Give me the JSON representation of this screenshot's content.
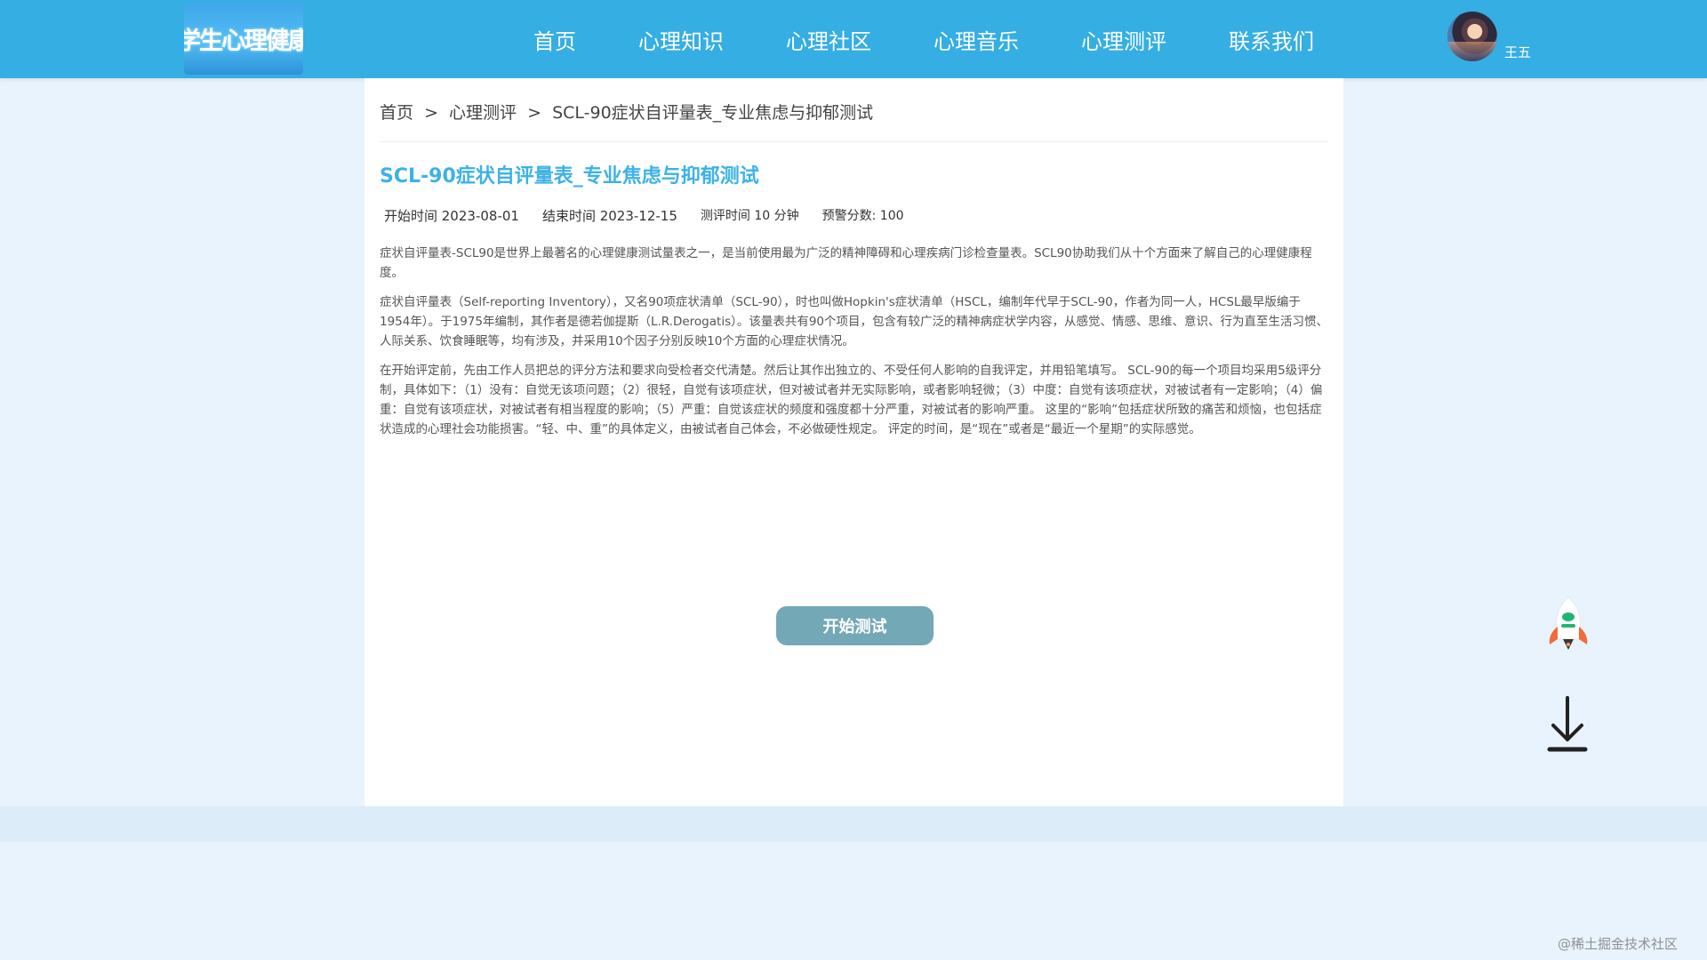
{
  "header": {
    "logo_text": "学生心理健康",
    "nav": [
      "首页",
      "心理知识",
      "心理社区",
      "心理音乐",
      "心理测评",
      "联系我们"
    ],
    "username": "王五",
    "background": "#35aee3"
  },
  "breadcrumb": {
    "home": "首页",
    "separator": ">",
    "section": "心理测评",
    "current": "SCL-90症状自评量表_专业焦虑与抑郁测试"
  },
  "test": {
    "title": "SCL-90症状自评量表_专业焦虑与抑郁测试",
    "title_color": "#3db2e6",
    "start_time": "开始时间 2023-08-01",
    "end_time": "结束时间 2023-12-15",
    "duration": "测评时间 10 分钟",
    "warning_score": "预警分数:  100",
    "paragraphs": [
      "症状自评量表-SCL90是世界上最著名的心理健康测试量表之一，是当前使用最为广泛的精神障碍和心理疾病门诊检查量表。SCL90协助我们从十个方面来了解自己的心理健康程度。",
      "症状自评量表（Self-reporting Inventory），又名90项症状清单（SCL-90），时也叫做Hopkin's症状清单（HSCL，编制年代早于SCL-90，作者为同一人，HCSL最早版编于1954年）。于1975年编制，其作者是德若伽提斯（L.R.Derogatis）。该量表共有90个项目，包含有较广泛的精神病症状学内容，从感觉、情感、思维、意识、行为直至生活习惯、人际关系、饮食睡眠等，均有涉及，并采用10个因子分别反映10个方面的心理症状情况。",
      "在开始评定前，先由工作人员把总的评分方法和要求向受检者交代清楚。然后让其作出独立的、不受任何人影响的自我评定，并用铅笔填写。 SCL-90的每一个项目均采用5级评分制，具体如下：（1）没有：自觉无该项问题；（2）很轻，自觉有该项症状，但对被试者并无实际影响，或者影响轻微；（3）中度：自觉有该项症状，对被试者有一定影响；（4）偏重：自觉有该项症状，对被试者有相当程度的影响；（5）严重：自觉该症状的频度和强度都十分严重，对被试者的影响严重。 这里的“影响”包括症状所致的痛苦和烦恼，也包括症状造成的心理社会功能损害。“轻、中、重”的具体定义，由被试者自己体会，不必做硬性规定。 评定的时间，是“现在”或者是“最近一个星期”的实际感觉。"
    ],
    "start_button": "开始测试",
    "button_color": "#73a8b6"
  },
  "widgets": {
    "rocket_icon": "rocket-icon",
    "download_icon": "download-arrow-icon"
  },
  "watermark": "@稀土掘金技术社区"
}
